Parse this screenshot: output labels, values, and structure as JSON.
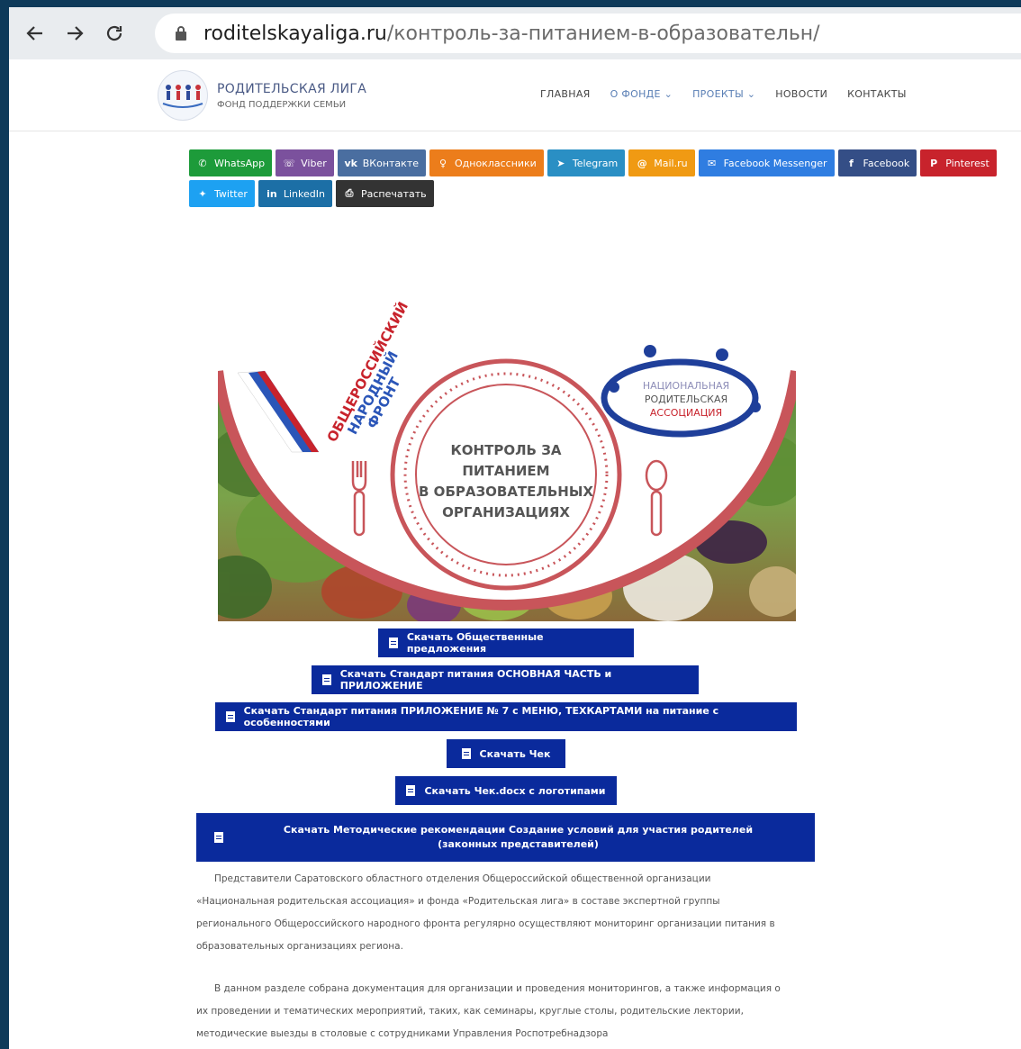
{
  "browser": {
    "url_domain": "roditelskayaliga.ru",
    "url_path": "/контроль-за-питанием-в-образовательн/"
  },
  "header": {
    "logo_title": "РОДИТЕЛЬСКАЯ ЛИГА",
    "logo_subtitle": "ФОНД ПОДДЕРЖКИ СЕМЬИ",
    "nav": [
      "ГЛАВНАЯ",
      "О ФОНДЕ ⌄",
      "ПРОЕКТЫ ⌄",
      "НОВОСТИ",
      "КОНТАКТЫ"
    ]
  },
  "share": {
    "row1": [
      {
        "label": "WhatsApp",
        "color": "#1d9b3a",
        "icon": "whatsapp-icon"
      },
      {
        "label": "Viber",
        "color": "#7b519d",
        "icon": "viber-icon"
      },
      {
        "label": "ВКонтакте",
        "color": "#4a6ea0",
        "icon": "vk-icon"
      },
      {
        "label": "Одноклассники",
        "color": "#ec7d1b",
        "icon": "ok-icon"
      },
      {
        "label": "Telegram",
        "color": "#2a8fc4",
        "icon": "telegram-icon"
      },
      {
        "label": "Mail.ru",
        "color": "#f09a13",
        "icon": "mailru-icon"
      },
      {
        "label": "Facebook Messenger",
        "color": "#2f7de1",
        "icon": "messenger-icon"
      },
      {
        "label": "Facebook",
        "color": "#344e86",
        "icon": "facebook-icon"
      },
      {
        "label": "Pinterest",
        "color": "#c8232c",
        "icon": "pinterest-icon"
      }
    ],
    "row2": [
      {
        "label": "Twitter",
        "color": "#1da1f2",
        "icon": "twitter-icon"
      },
      {
        "label": "LinkedIn",
        "color": "#1c6fa6",
        "icon": "linkedin-icon"
      },
      {
        "label": "Распечатать",
        "color": "#333333",
        "icon": "print-icon"
      }
    ]
  },
  "hero": {
    "center_lines": [
      "КОНТРОЛЬ ЗА",
      "ПИТАНИЕМ",
      "В ОБРАЗОВАТЕЛЬНЫХ",
      "ОРГАНИЗАЦИЯХ"
    ],
    "onf_lines": [
      "ОБЩЕРОССИЙСКИЙ",
      "НАРОДНЫЙ",
      "ФРОНТ"
    ],
    "npa_lines": [
      "НАЦИОНАЛЬНАЯ",
      "РОДИТЕЛЬСКАЯ",
      "АССОЦИАЦИЯ"
    ]
  },
  "downloads": [
    "Скачать Общественные предложения",
    "Скачать Стандарт питания ОСНОВНАЯ ЧАСТЬ и ПРИЛОЖЕНИЕ",
    "Скачать Стандарт питания ПРИЛОЖЕНИЕ № 7 с МЕНЮ, ТЕХКАРТАМИ на питание с особенностями",
    "Скачать Чек",
    "Скачать Чек.docx с логотипами",
    "Скачать Методические рекомендации Создание условий для участия родителей (законных представителей)"
  ],
  "paragraphs": [
    "Представители Саратовского областного отделения Общероссийской общественной организации «Национальная родительская ассоциация» и фонда «Родительская лига» в составе экспертной группы регионального Общероссийского народного фронта регулярно осуществляют мониторинг организации питания в образовательных организациях региона.",
    "В данном разделе собрана документация для организации и проведения мониторингов, а также информация о их проведении и тематических мероприятий, таких, как семинары, круглые столы, родительские лектории, методические выезды в столовые с сотрудниками Управления Роспотребнадзора"
  ],
  "colors": {
    "download_bg": "#0a2a9c",
    "plate_ring": "#c8555a",
    "npa_blue": "#1f3f9a"
  }
}
